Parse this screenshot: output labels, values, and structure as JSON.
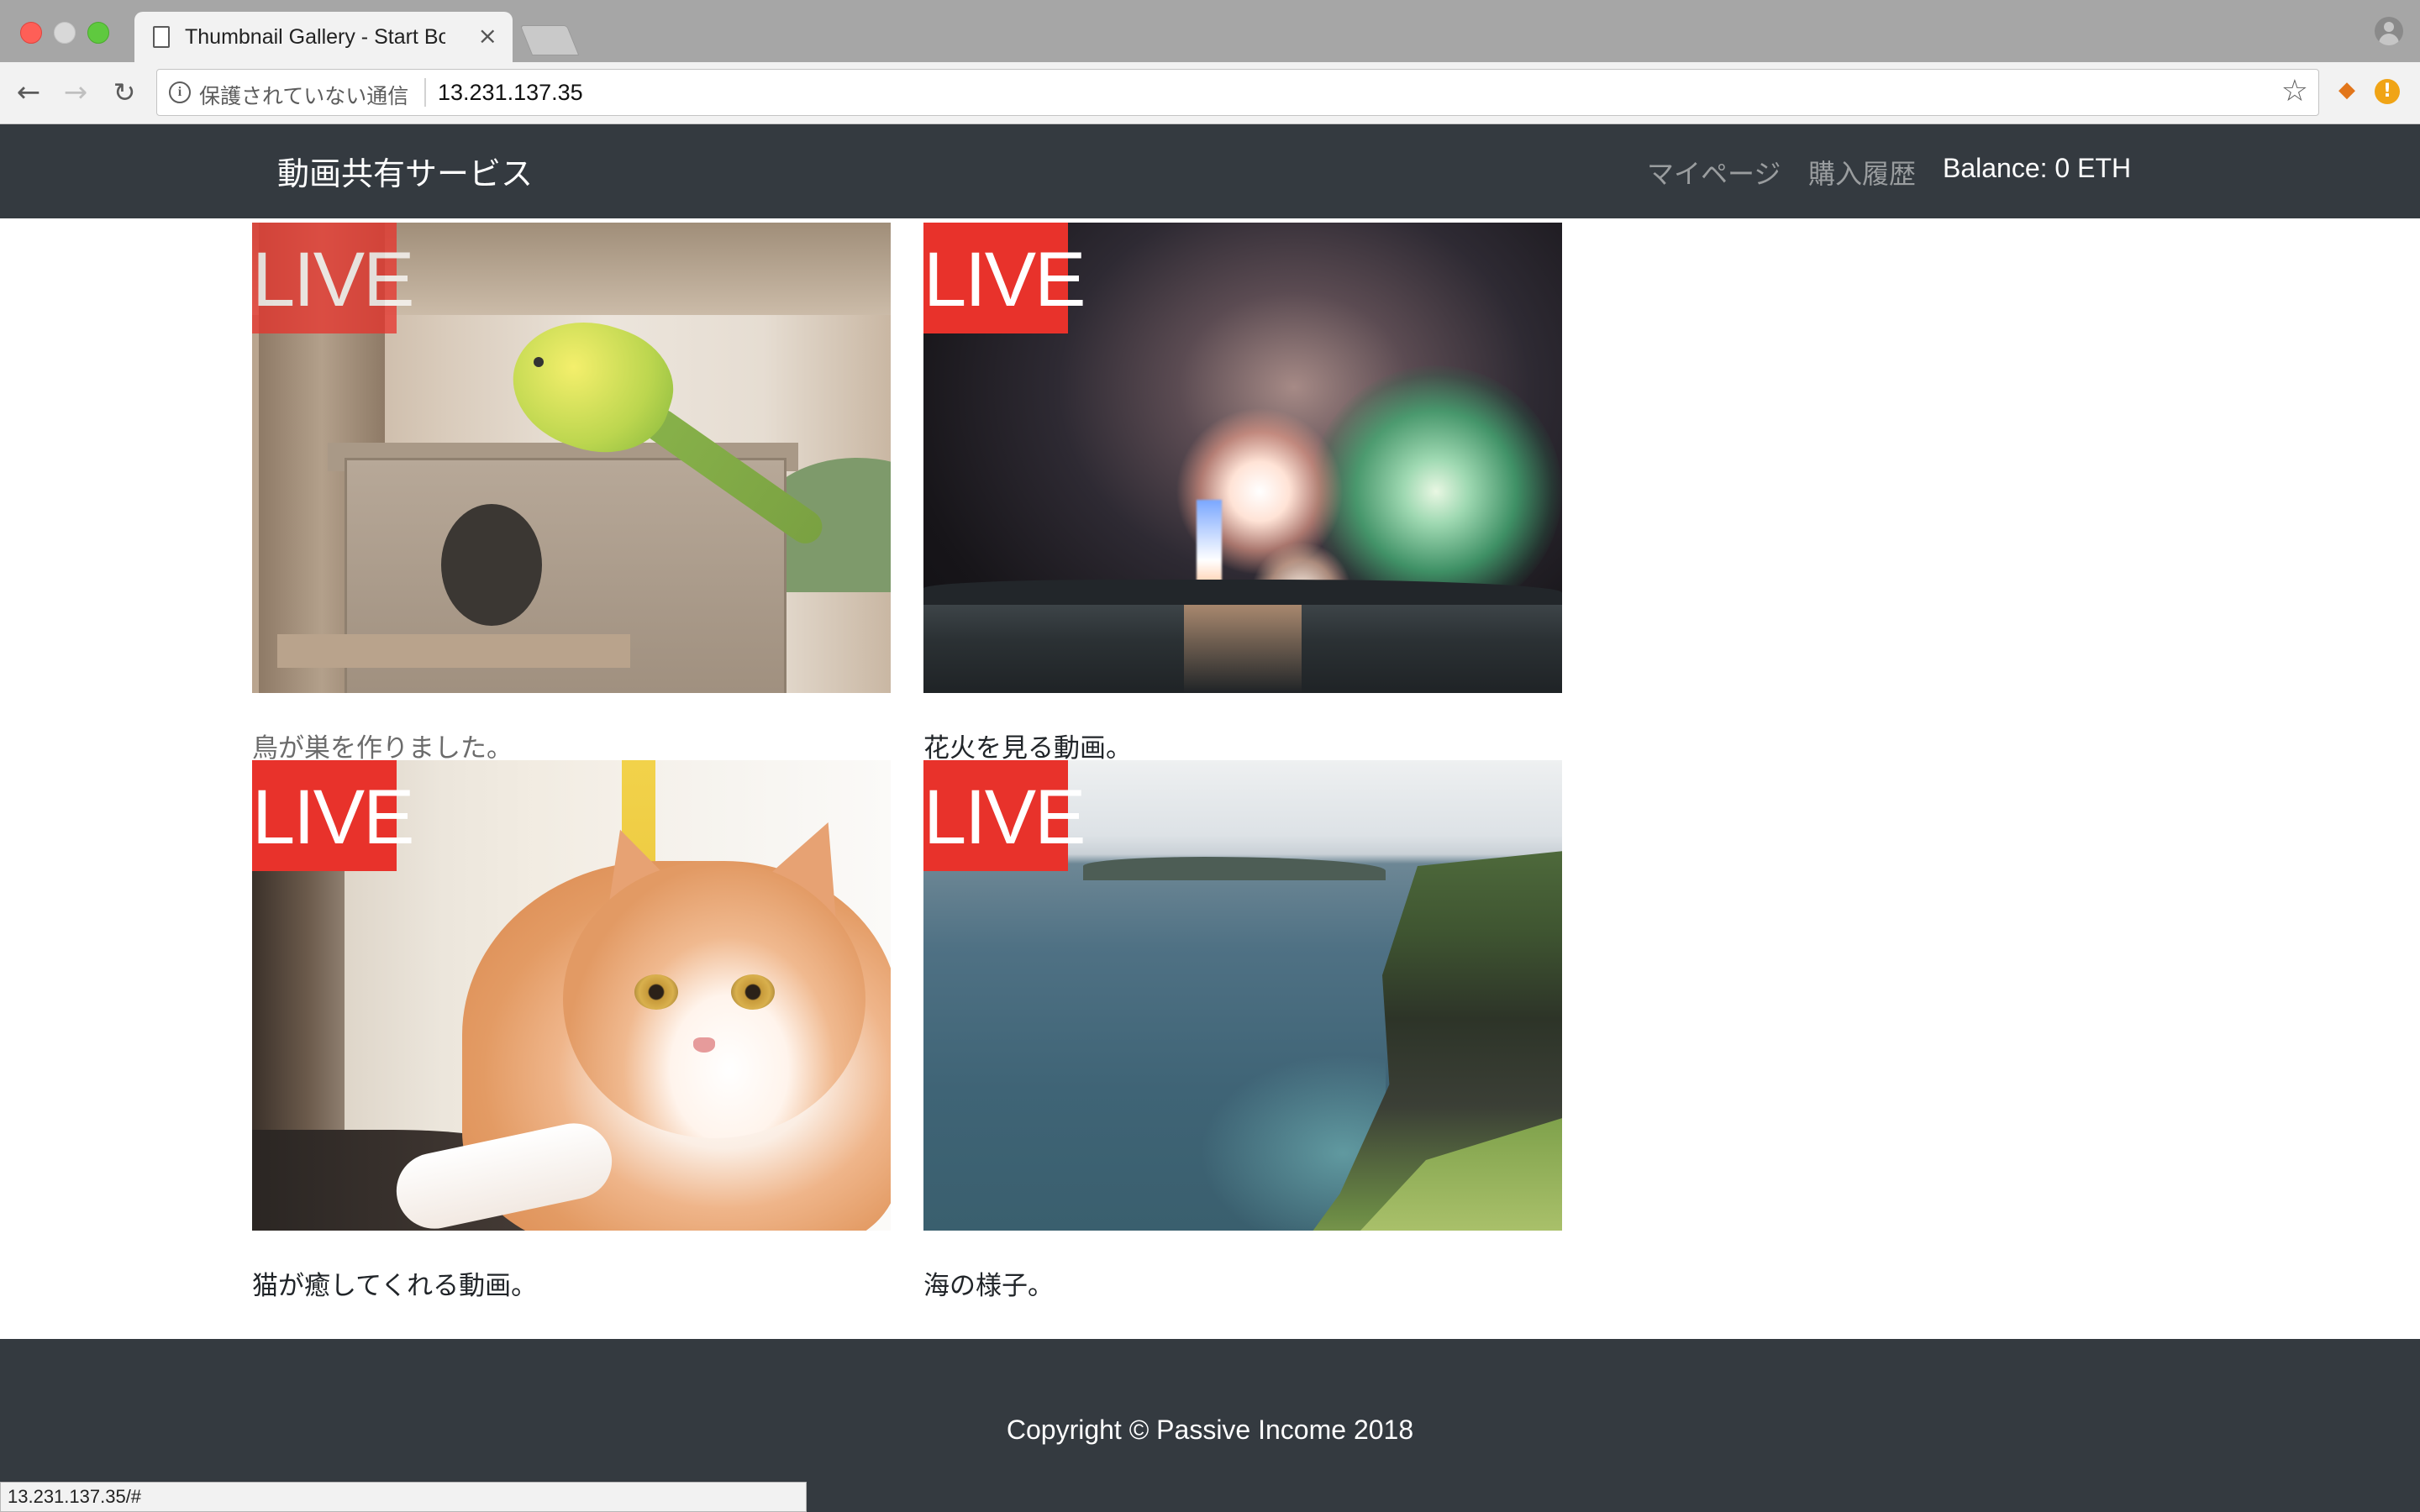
{
  "browser": {
    "tab_title": "Thumbnail Gallery - Start Boot",
    "tab_close": "×",
    "security_label": "保護されていない通信",
    "url": "13.231.137.35",
    "status_url": "13.231.137.35/#"
  },
  "icons": {
    "back": "arrow-left-icon",
    "forward": "arrow-right-icon",
    "reload": "reload-icon",
    "info": "info-icon",
    "star": "star-icon",
    "metamask": "fox-icon",
    "alert": "alert-icon",
    "profile": "profile-icon"
  },
  "navbar": {
    "brand": "動画共有サービス",
    "links": [
      {
        "label": "マイページ"
      },
      {
        "label": "購入履歴"
      }
    ],
    "balance": "Balance: 0 ETH"
  },
  "gallery": {
    "badge": "LIVE",
    "items": [
      {
        "caption": "鳥が巣を作りました。",
        "image": "parakeet-on-birdhouse"
      },
      {
        "caption": "花火を見る動画。",
        "image": "fireworks-over-sea"
      },
      {
        "caption": "猫が癒してくれる動画。",
        "image": "orange-white-cat"
      },
      {
        "caption": "海の様子。",
        "image": "sea-cliff-coast"
      }
    ]
  },
  "footer": {
    "copyright": "Copyright © Passive Income 2018"
  },
  "colors": {
    "navbar_bg": "#343a40",
    "live_badge": "#e8322b",
    "nav_link": "#9a9d9f"
  }
}
